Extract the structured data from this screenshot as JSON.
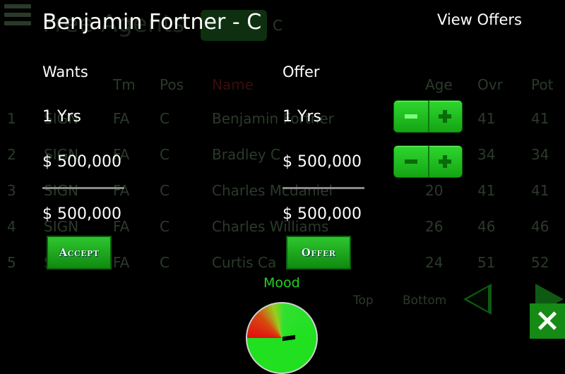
{
  "background": {
    "title": "Free Agents",
    "filter_text": "C",
    "columns": [
      "Tm",
      "Pos",
      "Name",
      "Age",
      "Ovr",
      "Pot"
    ],
    "rows": [
      {
        "num": "1",
        "action": "SIGN",
        "tm": "FA",
        "pos": "C",
        "name": "Benjamin Fortner",
        "age": "",
        "ovr": "41",
        "pot": "41"
      },
      {
        "num": "2",
        "action": "SIGN",
        "tm": "FA",
        "pos": "C",
        "name": "Bradley C",
        "age": "",
        "ovr": "34",
        "pot": "34"
      },
      {
        "num": "3",
        "action": "SIGN",
        "tm": "FA",
        "pos": "C",
        "name": "Charles Mcdaniel",
        "age": "20",
        "ovr": "41",
        "pot": "41"
      },
      {
        "num": "4",
        "action": "SIGN",
        "tm": "FA",
        "pos": "C",
        "name": "Charles Williams",
        "age": "26",
        "ovr": "46",
        "pot": "46"
      },
      {
        "num": "5",
        "action": "SIGN",
        "tm": "FA",
        "pos": "C",
        "name": "Curtis Ca",
        "age": "24",
        "ovr": "51",
        "pot": "52"
      }
    ],
    "scroll_top": "Top",
    "scroll_bottom": "Bottom"
  },
  "dialog": {
    "player_title": "Benjamin Fortner - C",
    "view_offers": "View Offers",
    "wants": {
      "header": "Wants",
      "years": "1 Yrs",
      "salary": "$ 500,000",
      "total": "$ 500,000",
      "button": "Accept"
    },
    "offer": {
      "header": "Offer",
      "years": "1 Yrs",
      "salary": "$ 500,000",
      "total": "$ 500,000",
      "button": "Offer"
    },
    "mood_label": "Mood",
    "colors": {
      "accent": "#1ea51e",
      "mood_text": "#22d022"
    }
  }
}
